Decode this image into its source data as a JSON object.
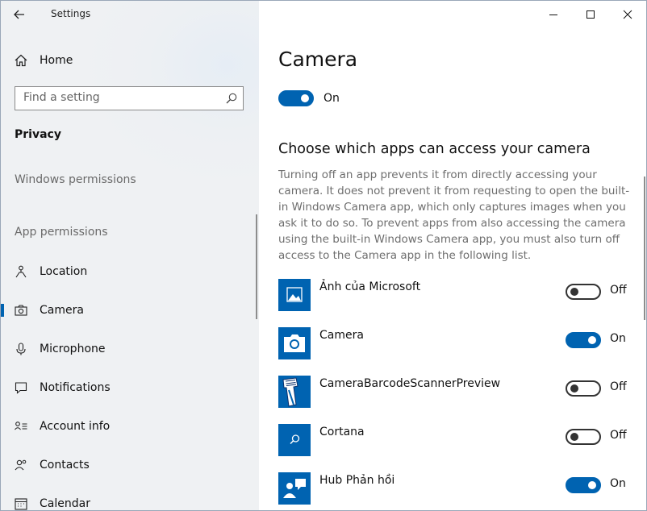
{
  "window": {
    "title": "Settings"
  },
  "sidebar": {
    "home_label": "Home",
    "search_placeholder": "Find a setting",
    "section": "Privacy",
    "groups": {
      "windows": "Windows permissions",
      "app": "App permissions"
    },
    "items": [
      {
        "label": "Location",
        "icon": "location-icon"
      },
      {
        "label": "Camera",
        "icon": "camera-icon",
        "selected": true
      },
      {
        "label": "Microphone",
        "icon": "microphone-icon"
      },
      {
        "label": "Notifications",
        "icon": "notifications-icon"
      },
      {
        "label": "Account info",
        "icon": "account-info-icon"
      },
      {
        "label": "Contacts",
        "icon": "contacts-icon"
      },
      {
        "label": "Calendar",
        "icon": "calendar-icon"
      }
    ]
  },
  "main": {
    "title": "Camera",
    "master_toggle": {
      "state": "on",
      "label": "On"
    },
    "subtitle": "Choose which apps can access your camera",
    "description": "Turning off an app prevents it from directly accessing your camera. It does not prevent it from requesting to open the built-in Windows Camera app, which only captures images when you ask it to do so. To prevent apps from also accessing the camera using the built-in Windows Camera app, you must also turn off access to the Camera app in the following list.",
    "apps": [
      {
        "name": "Ảnh của Microsoft",
        "state": "off",
        "state_label": "Off",
        "icon": "photos-app-icon"
      },
      {
        "name": "Camera",
        "state": "on",
        "state_label": "On",
        "icon": "camera-app-icon"
      },
      {
        "name": "CameraBarcodeScannerPreview",
        "state": "off",
        "state_label": "Off",
        "icon": "barcode-scanner-icon"
      },
      {
        "name": "Cortana",
        "state": "off",
        "state_label": "Off",
        "icon": "cortana-icon"
      },
      {
        "name": "Hub Phản hồi",
        "state": "on",
        "state_label": "On",
        "icon": "feedback-hub-icon"
      }
    ]
  },
  "colors": {
    "accent": "#0063b1",
    "sidebar_bg": "#eff1f3",
    "text_secondary": "#6e6e6e"
  }
}
